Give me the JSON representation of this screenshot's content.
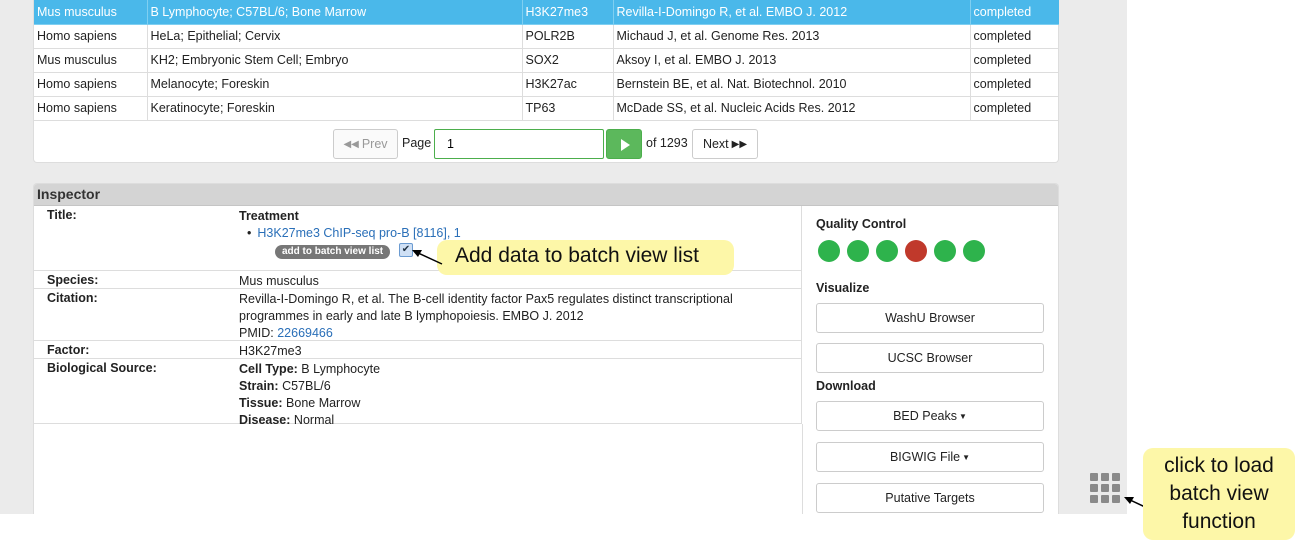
{
  "results": {
    "rows": [
      {
        "species": "Mus musculus",
        "source": "B Lymphocyte; C57BL/6; Bone Marrow",
        "factor": "H3K27me3",
        "citation": "Revilla-I-Domingo R, et al. EMBO J. 2012",
        "status": "completed",
        "selected": true
      },
      {
        "species": "Homo sapiens",
        "source": "HeLa; Epithelial; Cervix",
        "factor": "POLR2B",
        "citation": "Michaud J, et al. Genome Res. 2013",
        "status": "completed",
        "selected": false
      },
      {
        "species": "Mus musculus",
        "source": "KH2; Embryonic Stem Cell; Embryo",
        "factor": "SOX2",
        "citation": "Aksoy I, et al. EMBO J. 2013",
        "status": "completed",
        "selected": false
      },
      {
        "species": "Homo sapiens",
        "source": "Melanocyte; Foreskin",
        "factor": "H3K27ac",
        "citation": "Bernstein BE, et al. Nat. Biotechnol. 2010",
        "status": "completed",
        "selected": false
      },
      {
        "species": "Homo sapiens",
        "source": "Keratinocyte; Foreskin",
        "factor": "TP63",
        "citation": "McDade SS, et al. Nucleic Acids Res. 2012",
        "status": "completed",
        "selected": false
      }
    ]
  },
  "pager": {
    "prev_label": "Prev",
    "page_label": "Page",
    "page_value": "1",
    "of_label": "of 1293",
    "next_label": "Next"
  },
  "inspector": {
    "heading": "Inspector",
    "title_key": "Title:",
    "treatment_label": "Treatment",
    "treatment_link": "H3K27me3 ChIP-seq pro-B [8116], 1",
    "batch_button": "add to batch view list",
    "batch_checked": "✔",
    "species_key": "Species:",
    "species_value": "Mus musculus",
    "citation_key": "Citation:",
    "citation_line1": "Revilla-I-Domingo R, et al. The B-cell identity factor Pax5 regulates distinct transcriptional",
    "citation_line2": "programmes in early and late B lymphopoiesis. EMBO J. 2012",
    "pmid_label": "PMID:",
    "pmid_value": "22669466",
    "factor_key": "Factor:",
    "factor_value": "H3K27me3",
    "bio_key": "Biological Source:",
    "cell_type_label": "Cell Type:",
    "cell_type_value": "B Lymphocyte",
    "strain_label": "Strain:",
    "strain_value": "C57BL/6",
    "tissue_label": "Tissue:",
    "tissue_value": "Bone Marrow",
    "disease_label": "Disease:",
    "disease_value": "Normal"
  },
  "right_panel": {
    "qc_title": "Quality Control",
    "qc_colors": [
      "#2eb34c",
      "#2eb34c",
      "#2eb34c",
      "#c0392b",
      "#2eb34c",
      "#2eb34c"
    ],
    "visualize_title": "Visualize",
    "washu_label": "WashU Browser",
    "ucsc_label": "UCSC Browser",
    "download_title": "Download",
    "bed_label": "BED Peaks",
    "bigwig_label": "BIGWIG File",
    "targets_label": "Putative Targets"
  },
  "annotations": {
    "batch_callout": "Add data to batch view list",
    "load_callout_line1": "click to load",
    "load_callout_line2": "batch view",
    "load_callout_line3": "function"
  },
  "icons": {
    "prev": "double-chevron-left-icon",
    "next": "double-chevron-right-icon",
    "go": "play-icon",
    "batch": "grid-icon"
  },
  "colors": {
    "selected_row": "#4ab8ea",
    "go_button": "#5cb85c",
    "callout": "#fdf7a8",
    "link": "#2a6fb8"
  }
}
